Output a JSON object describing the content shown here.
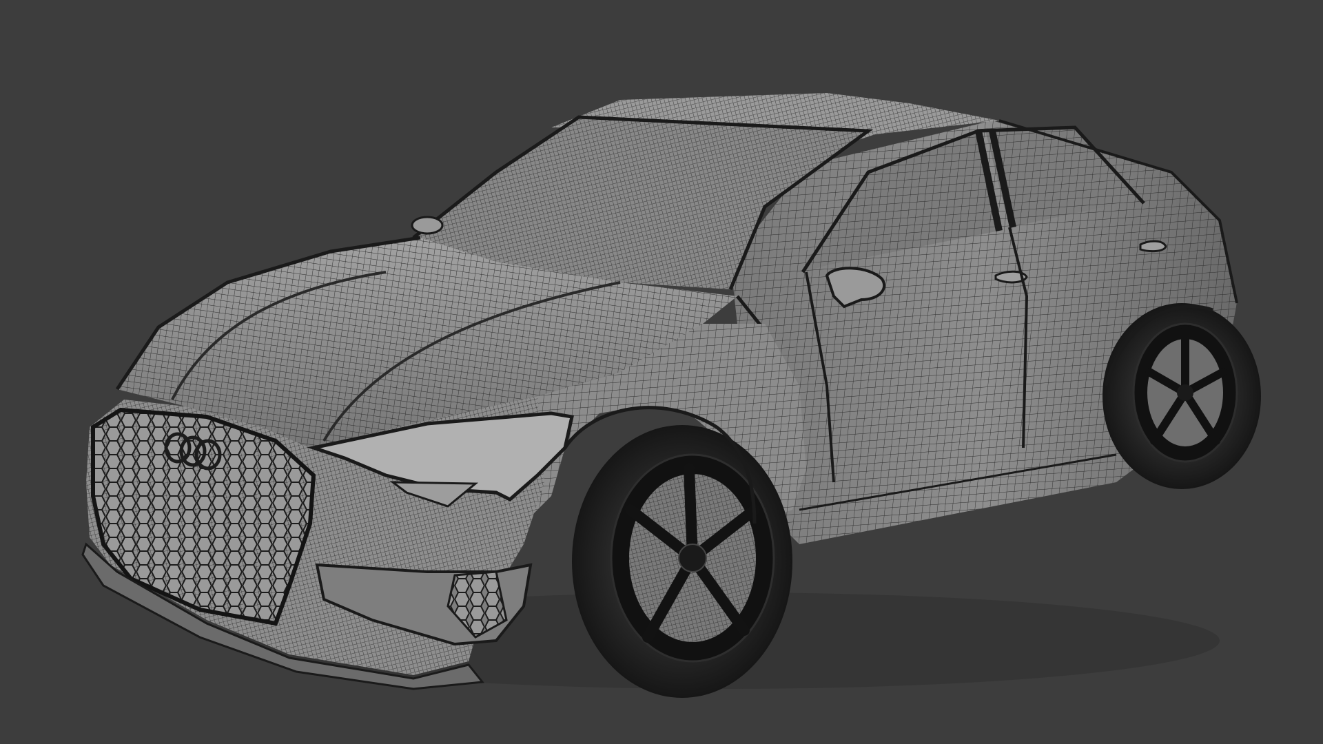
{
  "viewport": {
    "background_color": "#3d3d3d",
    "description_icon": "3d-viewport-wireframe-render"
  },
  "model": {
    "subject_icon": "sedan-car-wireframe-icon",
    "colors": {
      "body": "#8a8a8a",
      "body_shadow": "#5e5e5e",
      "body_light": "#a6a6a6",
      "wire": "#2a2a2a",
      "glass": "#7d7d7d",
      "tire": "#1f1f1f",
      "rim": "#141414",
      "grille": "#6e6e6e",
      "headlight": "#b4b4b4"
    }
  }
}
